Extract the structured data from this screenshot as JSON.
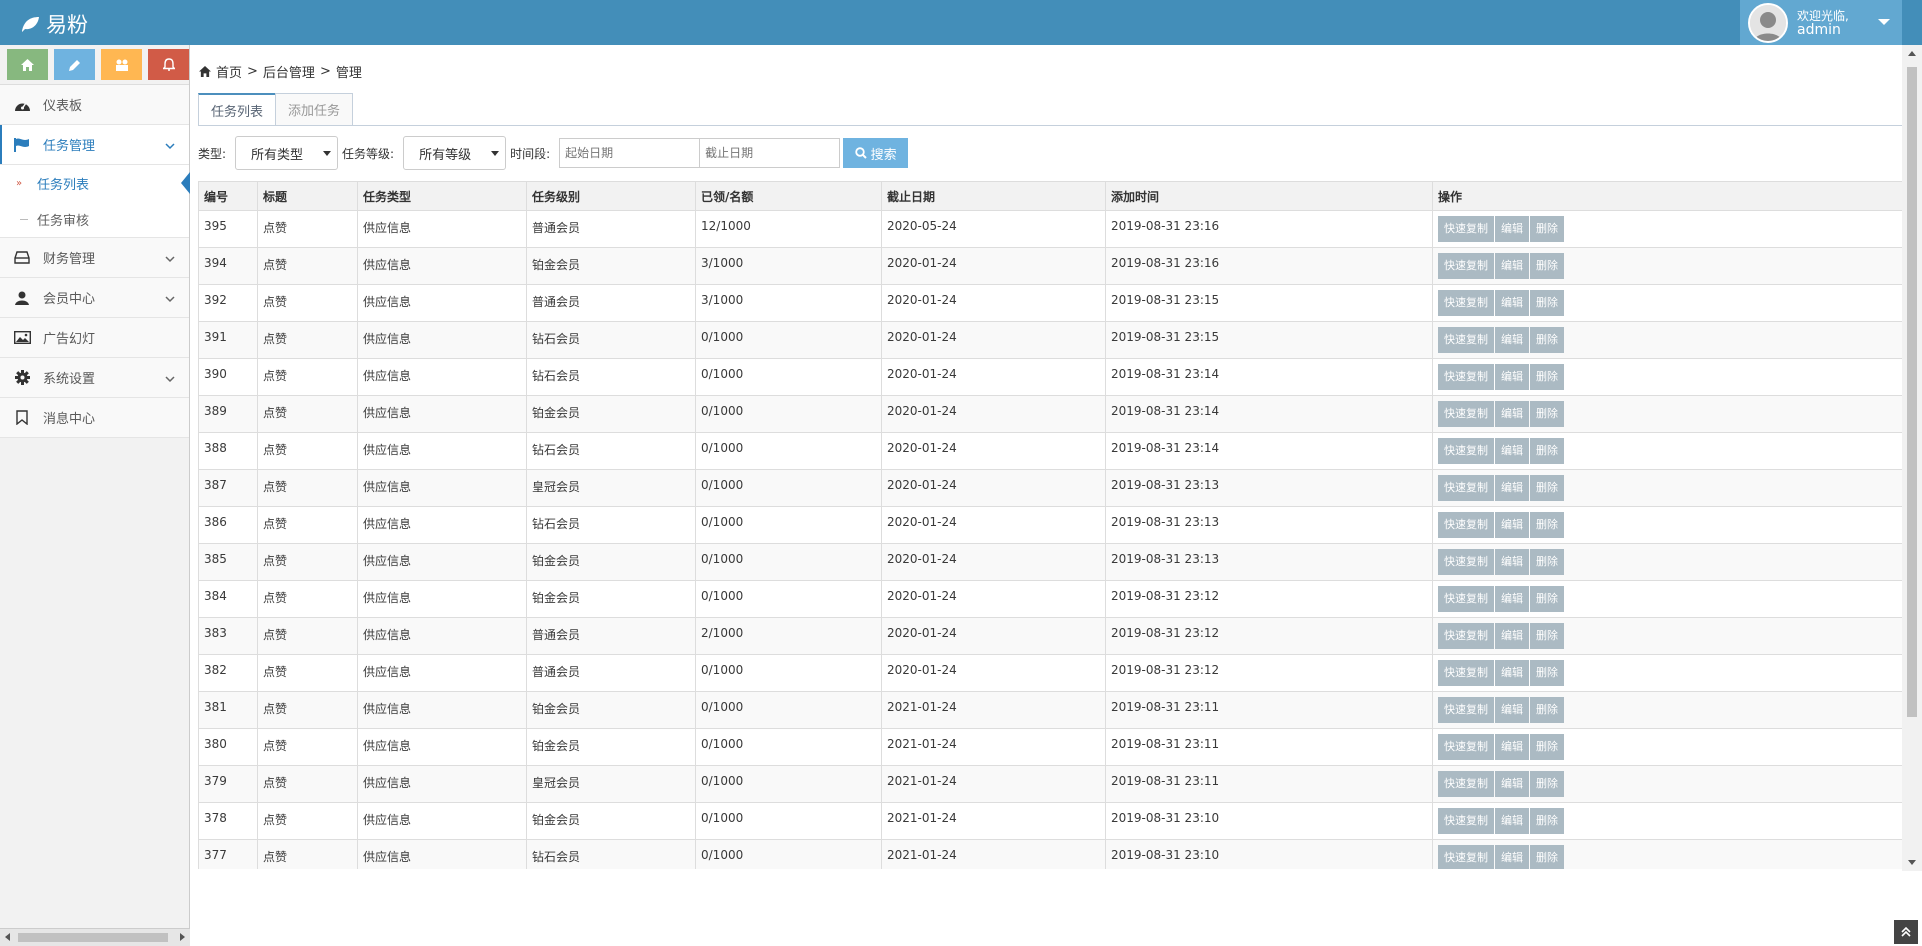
{
  "app": {
    "brand": "易粉"
  },
  "user": {
    "greeting": "欢迎光临,",
    "name": "admin"
  },
  "sidebar": {
    "shortcuts": [
      {
        "icon": "home-icon",
        "color": "#87b87f"
      },
      {
        "icon": "pencil-icon",
        "color": "#6fb3e0"
      },
      {
        "icon": "users-icon",
        "color": "#ffb752"
      },
      {
        "icon": "bell-icon",
        "color": "#d15b47"
      }
    ],
    "items": [
      {
        "label": "仪表板",
        "icon": "dashboard-icon"
      },
      {
        "label": "任务管理",
        "icon": "flag-icon"
      },
      {
        "label": "财务管理",
        "icon": "hdd-icon"
      },
      {
        "label": "会员中心",
        "icon": "user-icon"
      },
      {
        "label": "广告幻灯",
        "icon": "picture-icon"
      },
      {
        "label": "系统设置",
        "icon": "cog-icon"
      },
      {
        "label": "消息中心",
        "icon": "bookmark-icon"
      }
    ],
    "task_submenu": [
      {
        "label": "任务列表"
      },
      {
        "label": "任务审核"
      }
    ]
  },
  "breadcrumb": {
    "home": "首页",
    "sep1": ">",
    "level1": "后台管理",
    "sep2": ">",
    "level2": "管理"
  },
  "tabs": [
    {
      "label": "任务列表"
    },
    {
      "label": "添加任务"
    }
  ],
  "filters": {
    "type_label": "类型:",
    "type_value": "所有类型",
    "level_label": "任务等级:",
    "level_value": "所有等级",
    "period_label": "时间段:",
    "start_placeholder": "起始日期",
    "end_placeholder": "截止日期",
    "search_label": "搜索"
  },
  "table": {
    "headers": [
      "编号",
      "标题",
      "任务类型",
      "任务级别",
      "已领/名额",
      "截止日期",
      "添加时间",
      "操作"
    ],
    "actions": [
      "快速复制",
      "编辑",
      "删除"
    ],
    "rows": [
      [
        "395",
        "点赞",
        "供应信息",
        "普通会员",
        "12/1000",
        "2020-05-24",
        "2019-08-31 23:16"
      ],
      [
        "394",
        "点赞",
        "供应信息",
        "铂金会员",
        "3/1000",
        "2020-01-24",
        "2019-08-31 23:16"
      ],
      [
        "392",
        "点赞",
        "供应信息",
        "普通会员",
        "3/1000",
        "2020-01-24",
        "2019-08-31 23:15"
      ],
      [
        "391",
        "点赞",
        "供应信息",
        "钻石会员",
        "0/1000",
        "2020-01-24",
        "2019-08-31 23:15"
      ],
      [
        "390",
        "点赞",
        "供应信息",
        "钻石会员",
        "0/1000",
        "2020-01-24",
        "2019-08-31 23:14"
      ],
      [
        "389",
        "点赞",
        "供应信息",
        "铂金会员",
        "0/1000",
        "2020-01-24",
        "2019-08-31 23:14"
      ],
      [
        "388",
        "点赞",
        "供应信息",
        "钻石会员",
        "0/1000",
        "2020-01-24",
        "2019-08-31 23:14"
      ],
      [
        "387",
        "点赞",
        "供应信息",
        "皇冠会员",
        "0/1000",
        "2020-01-24",
        "2019-08-31 23:13"
      ],
      [
        "386",
        "点赞",
        "供应信息",
        "钻石会员",
        "0/1000",
        "2020-01-24",
        "2019-08-31 23:13"
      ],
      [
        "385",
        "点赞",
        "供应信息",
        "铂金会员",
        "0/1000",
        "2020-01-24",
        "2019-08-31 23:13"
      ],
      [
        "384",
        "点赞",
        "供应信息",
        "铂金会员",
        "0/1000",
        "2020-01-24",
        "2019-08-31 23:12"
      ],
      [
        "383",
        "点赞",
        "供应信息",
        "普通会员",
        "2/1000",
        "2020-01-24",
        "2019-08-31 23:12"
      ],
      [
        "382",
        "点赞",
        "供应信息",
        "普通会员",
        "0/1000",
        "2020-01-24",
        "2019-08-31 23:12"
      ],
      [
        "381",
        "点赞",
        "供应信息",
        "铂金会员",
        "0/1000",
        "2021-01-24",
        "2019-08-31 23:11"
      ],
      [
        "380",
        "点赞",
        "供应信息",
        "铂金会员",
        "0/1000",
        "2021-01-24",
        "2019-08-31 23:11"
      ],
      [
        "379",
        "点赞",
        "供应信息",
        "皇冠会员",
        "0/1000",
        "2021-01-24",
        "2019-08-31 23:11"
      ],
      [
        "378",
        "点赞",
        "供应信息",
        "铂金会员",
        "0/1000",
        "2021-01-24",
        "2019-08-31 23:10"
      ],
      [
        "377",
        "点赞",
        "供应信息",
        "钻石会员",
        "0/1000",
        "2021-01-24",
        "2019-08-31 23:10"
      ]
    ]
  }
}
